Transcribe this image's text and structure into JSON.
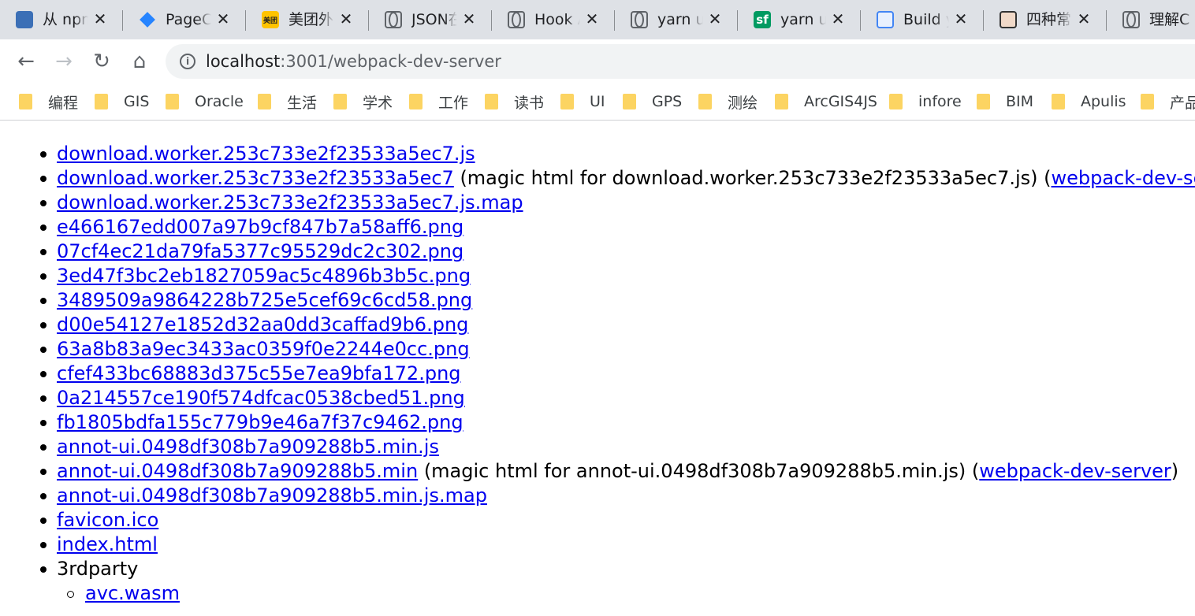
{
  "tabs": [
    {
      "title": "从 npm",
      "favicon": "npm-tree-icon"
    },
    {
      "title": "PageCo",
      "favicon": "diamond-icon"
    },
    {
      "title": "美团外卖",
      "favicon": "meituan-icon",
      "badge": "美团"
    },
    {
      "title": "JSON在",
      "favicon": "globe-icon"
    },
    {
      "title": "Hook A",
      "favicon": "globe-icon"
    },
    {
      "title": "yarn up",
      "favicon": "globe-icon"
    },
    {
      "title": "yarn up",
      "favicon": "segmentfault-icon",
      "badge": "sf"
    },
    {
      "title": "Build y",
      "favicon": "build-icon"
    },
    {
      "title": "四种常",
      "favicon": "avatar-icon"
    },
    {
      "title": "理解C",
      "favicon": "globe-icon"
    }
  ],
  "close_glyph": "✕",
  "toolbar": {
    "back": "←",
    "forward": "→",
    "reload": "↻",
    "home": "⌂",
    "info": "i",
    "url_host": "localhost",
    "url_rest": ":3001/webpack-dev-server"
  },
  "bookmarks": [
    "编程",
    "GIS",
    "Oracle",
    "生活",
    "学术",
    "工作",
    "读书",
    "UI",
    "GPS",
    "测绘",
    "ArcGIS4JS",
    "infore",
    "BIM",
    "Apulis",
    "产品"
  ],
  "files": [
    {
      "link": "download.worker.253c733e2f23533a5ec7.js"
    },
    {
      "link": "download.worker.253c733e2f23533a5ec7",
      "note": " (magic html for download.worker.253c733e2f23533a5ec7.js) (",
      "link2": "webpack-dev-server",
      "tail": ")"
    },
    {
      "link": "download.worker.253c733e2f23533a5ec7.js.map"
    },
    {
      "link": "e466167edd007a97b9cf847b7a58aff6.png"
    },
    {
      "link": "07cf4ec21da79fa5377c95529dc2c302.png"
    },
    {
      "link": "3ed47f3bc2eb1827059ac5c4896b3b5c.png"
    },
    {
      "link": "3489509a9864228b725e5cef69c6cd58.png"
    },
    {
      "link": "d00e54127e1852d32aa0dd3caffad9b6.png"
    },
    {
      "link": "63a8b83a9ec3433ac0359f0e2244e0cc.png"
    },
    {
      "link": "cfef433bc68883d375c55e7ea9bfa172.png"
    },
    {
      "link": "0a214557ce190f574dfcac0538cbed51.png"
    },
    {
      "link": "fb1805bdfa155c779b9e46a7f37c9462.png"
    },
    {
      "link": "annot-ui.0498df308b7a909288b5.min.js"
    },
    {
      "link": "annot-ui.0498df308b7a909288b5.min",
      "note": " (magic html for annot-ui.0498df308b7a909288b5.min.js) (",
      "link2": "webpack-dev-server",
      "tail": ")"
    },
    {
      "link": "annot-ui.0498df308b7a909288b5.min.js.map"
    },
    {
      "link": "favicon.ico"
    },
    {
      "link": "index.html"
    }
  ],
  "folder": {
    "name": "3rdparty",
    "children": [
      "avc.wasm"
    ]
  }
}
